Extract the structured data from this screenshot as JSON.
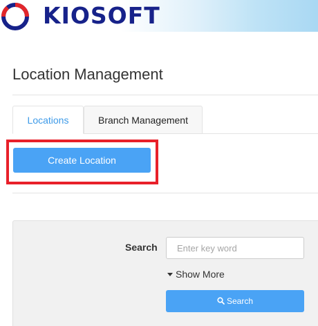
{
  "header": {
    "logo_text": "KIOSOFT",
    "logo_icon": "kiosoft-logo-icon",
    "colors": {
      "logo_blue": "#17228a",
      "logo_red": "#e2262b"
    }
  },
  "page": {
    "title": "Location Management"
  },
  "tabs": [
    {
      "label": "Locations",
      "active": true
    },
    {
      "label": "Branch Management",
      "active": false
    }
  ],
  "actions": {
    "create_label": "Create Location"
  },
  "search": {
    "label": "Search",
    "placeholder": "Enter key word",
    "value": "",
    "show_more_label": "Show More",
    "button_label": "Search",
    "button_icon": "search-icon"
  },
  "colors": {
    "accent": "#4aa3f5",
    "active_tab_text": "#3d9ae8",
    "highlight_border": "#e8202a"
  }
}
